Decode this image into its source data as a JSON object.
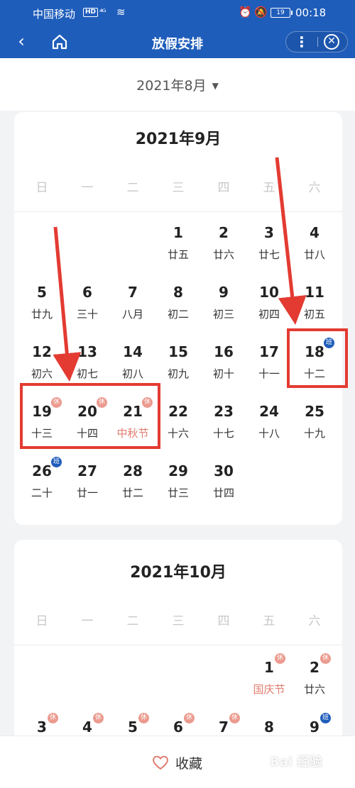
{
  "status_bar": {
    "carrier": "中国移动",
    "hd": "HD",
    "signal": "⁴ᴳ",
    "battery": "19",
    "time": "00:18"
  },
  "title_bar": {
    "back_icon": "chevron-left-icon",
    "home_icon": "home-icon",
    "title": "放假安排",
    "more_icon": "more-vertical-icon",
    "close_icon": "close-circle-icon"
  },
  "month_picker": {
    "label": "2021年8月",
    "caret": "▼"
  },
  "weekdays": [
    "日",
    "一",
    "二",
    "三",
    "四",
    "五",
    "六"
  ],
  "months": [
    {
      "title": "2021年9月",
      "days": [
        {
          "day": "1",
          "lunar": "廿五",
          "col": 3,
          "row": 0
        },
        {
          "day": "2",
          "lunar": "廿六",
          "col": 4,
          "row": 0
        },
        {
          "day": "3",
          "lunar": "廿七",
          "col": 5,
          "row": 0
        },
        {
          "day": "4",
          "lunar": "廿八",
          "col": 6,
          "row": 0
        },
        {
          "day": "5",
          "lunar": "廿九",
          "col": 0,
          "row": 1
        },
        {
          "day": "6",
          "lunar": "三十",
          "col": 1,
          "row": 1
        },
        {
          "day": "7",
          "lunar": "八月",
          "col": 2,
          "row": 1
        },
        {
          "day": "8",
          "lunar": "初二",
          "col": 3,
          "row": 1
        },
        {
          "day": "9",
          "lunar": "初三",
          "col": 4,
          "row": 1
        },
        {
          "day": "10",
          "lunar": "初四",
          "col": 5,
          "row": 1
        },
        {
          "day": "11",
          "lunar": "初五",
          "col": 6,
          "row": 1
        },
        {
          "day": "12",
          "lunar": "初六",
          "col": 0,
          "row": 2
        },
        {
          "day": "13",
          "lunar": "初七",
          "col": 1,
          "row": 2
        },
        {
          "day": "14",
          "lunar": "初八",
          "col": 2,
          "row": 2
        },
        {
          "day": "15",
          "lunar": "初九",
          "col": 3,
          "row": 2
        },
        {
          "day": "16",
          "lunar": "初十",
          "col": 4,
          "row": 2
        },
        {
          "day": "17",
          "lunar": "十一",
          "col": 5,
          "row": 2
        },
        {
          "day": "18",
          "lunar": "十二",
          "col": 6,
          "row": 2,
          "badge": "班",
          "badge_type": "work"
        },
        {
          "day": "19",
          "lunar": "十三",
          "col": 0,
          "row": 3,
          "badge": "休",
          "badge_type": "rest"
        },
        {
          "day": "20",
          "lunar": "十四",
          "col": 1,
          "row": 3,
          "badge": "休",
          "badge_type": "rest"
        },
        {
          "day": "21",
          "lunar": "中秋节",
          "col": 2,
          "row": 3,
          "badge": "休",
          "badge_type": "rest",
          "festival": true
        },
        {
          "day": "22",
          "lunar": "十六",
          "col": 3,
          "row": 3
        },
        {
          "day": "23",
          "lunar": "十七",
          "col": 4,
          "row": 3
        },
        {
          "day": "24",
          "lunar": "十八",
          "col": 5,
          "row": 3
        },
        {
          "day": "25",
          "lunar": "十九",
          "col": 6,
          "row": 3
        },
        {
          "day": "26",
          "lunar": "二十",
          "col": 0,
          "row": 4,
          "badge": "班",
          "badge_type": "work"
        },
        {
          "day": "27",
          "lunar": "廿一",
          "col": 1,
          "row": 4
        },
        {
          "day": "28",
          "lunar": "廿二",
          "col": 2,
          "row": 4
        },
        {
          "day": "29",
          "lunar": "廿三",
          "col": 3,
          "row": 4
        },
        {
          "day": "30",
          "lunar": "廿四",
          "col": 4,
          "row": 4
        }
      ]
    },
    {
      "title": "2021年10月",
      "days": [
        {
          "day": "1",
          "lunar": "国庆节",
          "col": 5,
          "row": 0,
          "badge": "休",
          "badge_type": "rest",
          "festival": true
        },
        {
          "day": "2",
          "lunar": "廿六",
          "col": 6,
          "row": 0,
          "badge": "休",
          "badge_type": "rest"
        },
        {
          "day": "3",
          "lunar": "",
          "col": 0,
          "row": 1,
          "badge": "休",
          "badge_type": "rest"
        },
        {
          "day": "4",
          "lunar": "",
          "col": 1,
          "row": 1,
          "badge": "休",
          "badge_type": "rest"
        },
        {
          "day": "5",
          "lunar": "",
          "col": 2,
          "row": 1,
          "badge": "休",
          "badge_type": "rest"
        },
        {
          "day": "6",
          "lunar": "",
          "col": 3,
          "row": 1,
          "badge": "休",
          "badge_type": "rest"
        },
        {
          "day": "7",
          "lunar": "",
          "col": 4,
          "row": 1,
          "badge": "休",
          "badge_type": "rest"
        },
        {
          "day": "8",
          "lunar": "",
          "col": 5,
          "row": 1
        },
        {
          "day": "9",
          "lunar": "",
          "col": 6,
          "row": 1,
          "badge": "班",
          "badge_type": "work"
        }
      ]
    }
  ],
  "bottom_bar": {
    "favorite_label": "收藏",
    "heart_icon": "heart-outline-icon"
  },
  "watermark": "Bai 经验",
  "colors": {
    "header": "#1f5dbb",
    "rest_badge": "#eb9a8e",
    "work_badge": "#1f5dbb",
    "festival_text": "#e07d6f",
    "annotation_red": "#e33b32"
  }
}
